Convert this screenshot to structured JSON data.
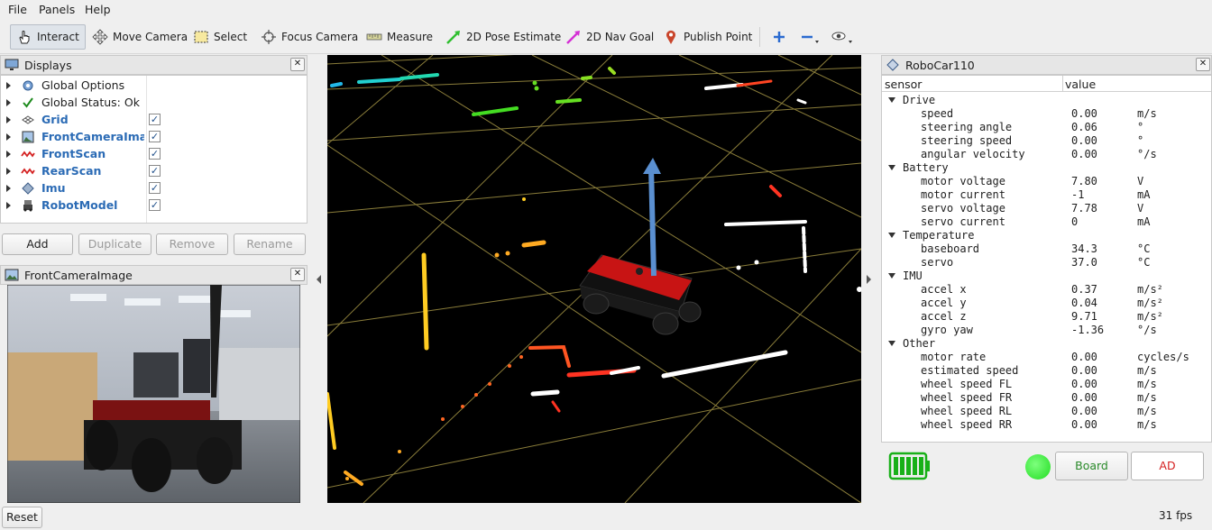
{
  "menu": {
    "file": "File",
    "panels": "Panels",
    "help": "Help"
  },
  "toolbar": {
    "interact": "Interact",
    "move_camera": "Move Camera",
    "select": "Select",
    "focus_camera": "Focus Camera",
    "measure": "Measure",
    "pose_estimate": "2D Pose Estimate",
    "nav_goal": "2D Nav Goal",
    "publish_point": "Publish Point"
  },
  "displays": {
    "title": "Displays",
    "items": [
      {
        "label": "Global Options",
        "icon": "gear-icon",
        "checkbox": false
      },
      {
        "label": "Global Status: Ok",
        "icon": "checkmark-icon",
        "checkbox": false
      },
      {
        "label": "Grid",
        "icon": "grid-icon",
        "checkbox": true
      },
      {
        "label": "FrontCameraIma...",
        "icon": "image-icon",
        "checkbox": true
      },
      {
        "label": "FrontScan",
        "icon": "laser-icon",
        "checkbox": true
      },
      {
        "label": "RearScan",
        "icon": "laser-icon",
        "checkbox": true
      },
      {
        "label": "Imu",
        "icon": "imu-icon",
        "checkbox": true
      },
      {
        "label": "RobotModel",
        "icon": "robot-icon",
        "checkbox": true
      }
    ],
    "buttons": {
      "add": "Add",
      "duplicate": "Duplicate",
      "remove": "Remove",
      "rename": "Rename"
    }
  },
  "camera_panel": {
    "title": "FrontCameraImage"
  },
  "robocar": {
    "title": "RoboCar110",
    "columns": {
      "sensor": "sensor",
      "value": "value"
    },
    "groups": [
      {
        "name": "Drive",
        "rows": [
          {
            "name": "speed",
            "value": "0.00",
            "unit": "m/s"
          },
          {
            "name": "steering angle",
            "value": "0.06",
            "unit": "°"
          },
          {
            "name": "steering speed",
            "value": "0.00",
            "unit": "°"
          },
          {
            "name": "angular velocity",
            "value": "0.00",
            "unit": "°/s"
          }
        ]
      },
      {
        "name": "Battery",
        "rows": [
          {
            "name": "motor voltage",
            "value": "7.80",
            "unit": "V"
          },
          {
            "name": "motor current",
            "value": "-1",
            "unit": "mA"
          },
          {
            "name": "servo voltage",
            "value": "7.78",
            "unit": "V"
          },
          {
            "name": "servo current",
            "value": "0",
            "unit": "mA"
          }
        ]
      },
      {
        "name": "Temperature",
        "rows": [
          {
            "name": "baseboard",
            "value": "34.3",
            "unit": "°C"
          },
          {
            "name": "servo",
            "value": "37.0",
            "unit": "°C"
          }
        ]
      },
      {
        "name": "IMU",
        "rows": [
          {
            "name": "accel x",
            "value": "0.37",
            "unit": "m/s²"
          },
          {
            "name": "accel y",
            "value": "0.04",
            "unit": "m/s²"
          },
          {
            "name": "accel z",
            "value": "9.71",
            "unit": "m/s²"
          },
          {
            "name": "gyro yaw",
            "value": "-1.36",
            "unit": "°/s"
          }
        ]
      },
      {
        "name": "Other",
        "rows": [
          {
            "name": "motor rate",
            "value": "0.00",
            "unit": "cycles/s"
          },
          {
            "name": "estimated speed",
            "value": "0.00",
            "unit": "m/s"
          },
          {
            "name": "wheel speed FL",
            "value": "0.00",
            "unit": "m/s"
          },
          {
            "name": "wheel speed FR",
            "value": "0.00",
            "unit": "m/s"
          },
          {
            "name": "wheel speed RL",
            "value": "0.00",
            "unit": "m/s"
          },
          {
            "name": "wheel speed RR",
            "value": "0.00",
            "unit": "m/s"
          }
        ]
      }
    ],
    "battery_level": 1.0,
    "status_color": "#22dd22",
    "board_button": "Board",
    "ad_button": "AD",
    "board_color": "#2a8a2a",
    "ad_color": "#d42020"
  },
  "status": {
    "reset": "Reset",
    "fps": "31 fps"
  }
}
